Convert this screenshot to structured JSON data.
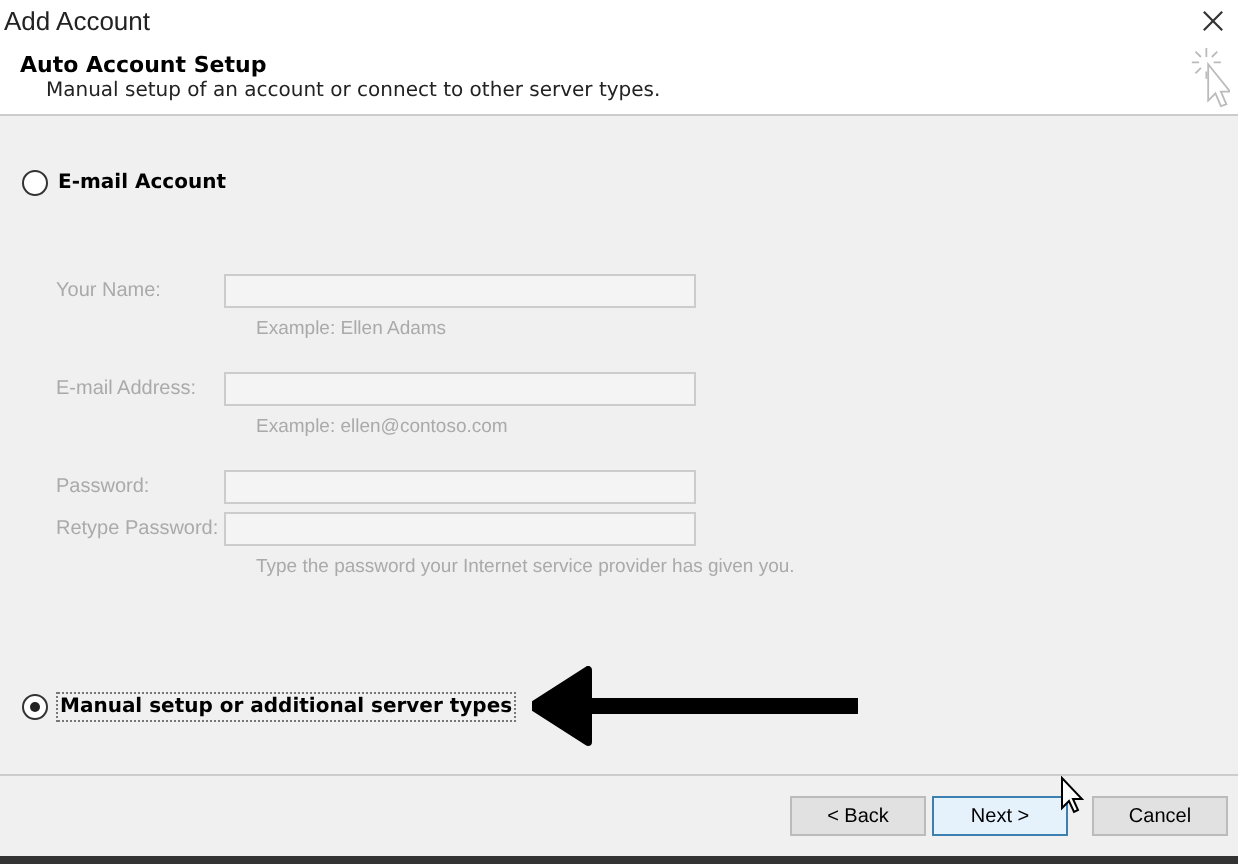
{
  "window": {
    "title": "Add Account"
  },
  "header": {
    "title": "Auto Account Setup",
    "subtitle": "Manual setup of an account or connect to other server types."
  },
  "options": [
    {
      "label": "E-mail Account",
      "selected": false
    },
    {
      "label": "Manual setup or additional server types",
      "selected": true
    }
  ],
  "fields": [
    {
      "label": "Your Name:",
      "hint": "Example: Ellen Adams",
      "disabled": true
    },
    {
      "label": "E-mail Address:",
      "hint": "Example: ellen@contoso.com",
      "disabled": true
    },
    {
      "label": "Password:",
      "disabled": true
    },
    {
      "label": "Retype Password:",
      "hint": "Type the password your Internet service provider has given you.",
      "disabled": true
    }
  ],
  "buttons": [
    {
      "label": "< Back",
      "default": false
    },
    {
      "label": "Next >",
      "default": true
    },
    {
      "label": "Cancel",
      "default": false
    }
  ]
}
